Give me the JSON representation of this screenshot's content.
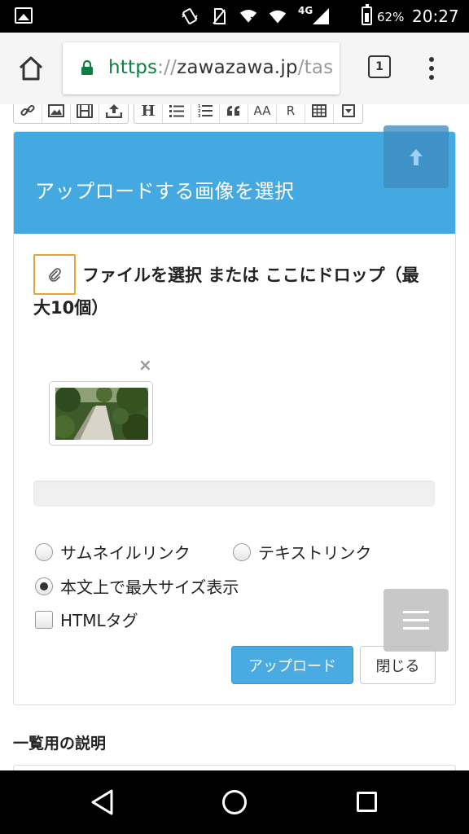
{
  "status_bar": {
    "network": "4G",
    "battery_percent": "62%",
    "time": "20:27"
  },
  "browser": {
    "url_scheme": "https",
    "url_separator": "://",
    "url_host": "zawazawa.jp",
    "url_path": "/tas",
    "tab_count": "1",
    "secure_color": "#0b8043"
  },
  "editor_toolbar": {
    "groups": [
      [
        "link-icon",
        "image-icon",
        "film-icon",
        "upload-icon"
      ],
      [
        "heading H",
        "unordered-list-icon",
        "ordered-list-icon",
        "quote-icon",
        "AA",
        "R",
        "table-icon",
        "dropdown-icon"
      ]
    ],
    "heading_label": "H",
    "font_size_label": "AA",
    "ruby_label": "R"
  },
  "upload_dialog": {
    "title": "アップロードする画像を選択",
    "header_color": "#44a9e0",
    "drop_text_line1": "ファイルを選択 または ここにドロップ（最",
    "drop_text_line2": "大10個）",
    "remove_symbol": "×",
    "options": {
      "thumbnail_link": "サムネイルリンク",
      "text_link": "テキストリンク",
      "max_size_display": "本文上で最大サイズ表示",
      "html_tag": "HTMLタグ"
    },
    "selected_option": "max_size_display",
    "html_tag_checked": false,
    "upload_button": "アップロード",
    "close_button": "閉じる",
    "upload_button_color": "#4aabe3"
  },
  "section_label": "一覧用の説明"
}
